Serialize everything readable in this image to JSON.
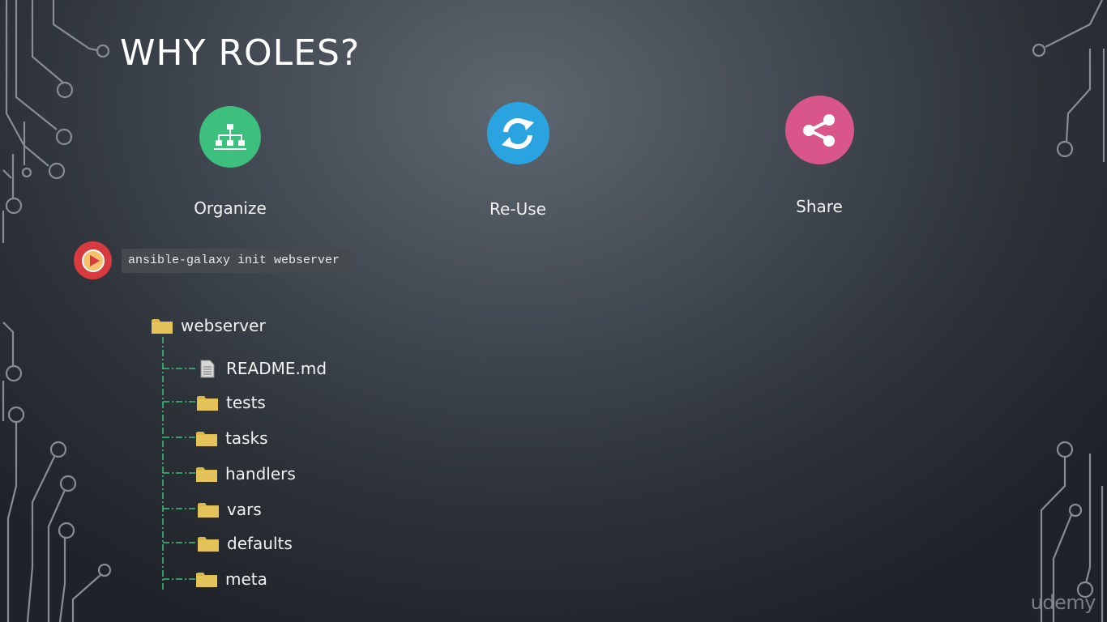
{
  "slide": {
    "title": "WHY ROLES?"
  },
  "features": [
    {
      "label": "Organize",
      "icon": "hierarchy-icon",
      "color": "#3dbf7e"
    },
    {
      "label": "Re-Use",
      "icon": "refresh-icon",
      "color": "#2aa4e0"
    },
    {
      "label": "Share",
      "icon": "share-icon",
      "color": "#d8568a"
    }
  ],
  "command": {
    "text": "ansible-galaxy init webserver",
    "play_icon": "play-icon",
    "play_color": "#d83b3f"
  },
  "tree": {
    "root": "webserver",
    "children": [
      {
        "name": "README.md",
        "type": "file"
      },
      {
        "name": "tests",
        "type": "folder"
      },
      {
        "name": "tasks",
        "type": "folder"
      },
      {
        "name": "handlers",
        "type": "folder"
      },
      {
        "name": "vars",
        "type": "folder"
      },
      {
        "name": "defaults",
        "type": "folder"
      },
      {
        "name": "meta",
        "type": "folder"
      }
    ]
  },
  "watermark": "udemy",
  "colors": {
    "folder": "#d9b847",
    "tree_line": "#3dbf7e",
    "circuit": "#8a9096"
  }
}
